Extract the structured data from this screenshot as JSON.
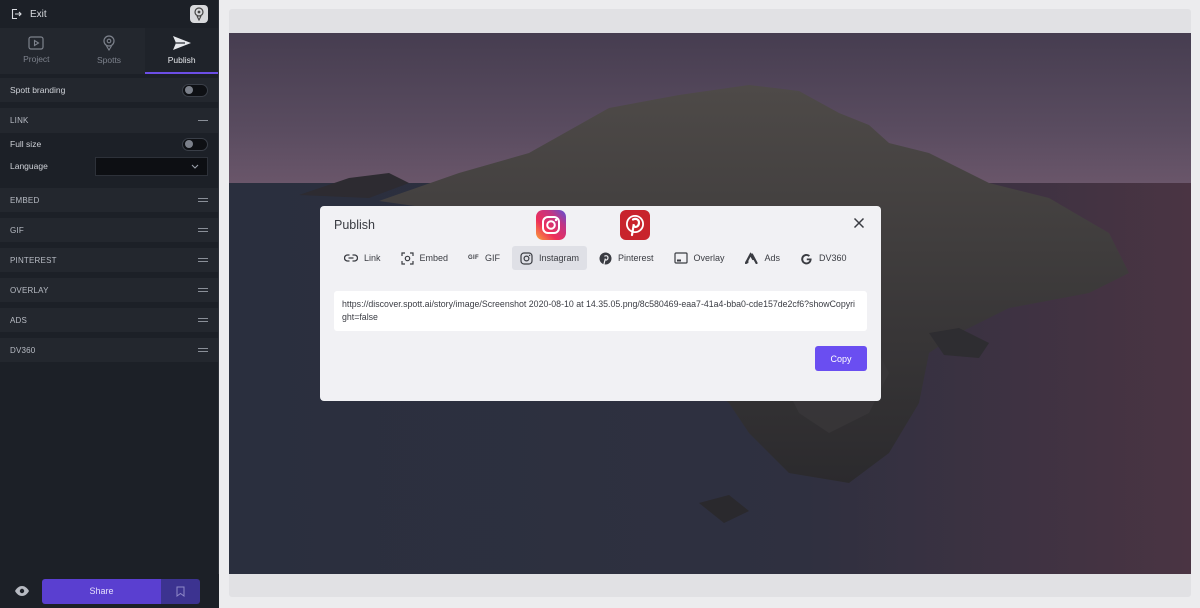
{
  "sidebar": {
    "exit_label": "Exit",
    "tabs": [
      {
        "label": "Project",
        "icon": "play-icon"
      },
      {
        "label": "Spotts",
        "icon": "spott-icon"
      },
      {
        "label": "Publish",
        "icon": "send-icon"
      }
    ],
    "active_tab": "Publish",
    "spott_branding_label": "Spott branding",
    "sections": {
      "link": "LINK",
      "full_size_label": "Full size",
      "language_label": "Language",
      "language_value": "",
      "embed": "EMBED",
      "gif": "GIF",
      "pinterest": "PINTEREST",
      "overlay": "OVERLAY",
      "ads": "ADS",
      "dv360": "DV360"
    },
    "share_label": "Share"
  },
  "modal": {
    "title": "Publish",
    "tabs": [
      {
        "label": "Link",
        "icon": "link-icon"
      },
      {
        "label": "Embed",
        "icon": "embed-icon"
      },
      {
        "label": "GIF",
        "icon": "gif-icon"
      },
      {
        "label": "Instagram",
        "icon": "instagram-icon"
      },
      {
        "label": "Pinterest",
        "icon": "pinterest-icon"
      },
      {
        "label": "Overlay",
        "icon": "overlay-icon"
      },
      {
        "label": "Ads",
        "icon": "ads-icon"
      },
      {
        "label": "DV360",
        "icon": "google-icon"
      }
    ],
    "active_tab": "Instagram",
    "gif_icon_text": "GIF",
    "url": "https://discover.spott.ai/story/image/Screenshot 2020-08-10 at 14.35.05.png/8c580469-eaa7-41a4-bba0-cde157de2cf6?showCopyright=false",
    "copy_label": "Copy"
  },
  "colors": {
    "accent": "#6a4ef1",
    "share_button": "#5a3fd0",
    "sidebar_bg": "#1c2027",
    "modal_bg": "#f1f1f4",
    "pinterest_red": "#c8232c"
  }
}
